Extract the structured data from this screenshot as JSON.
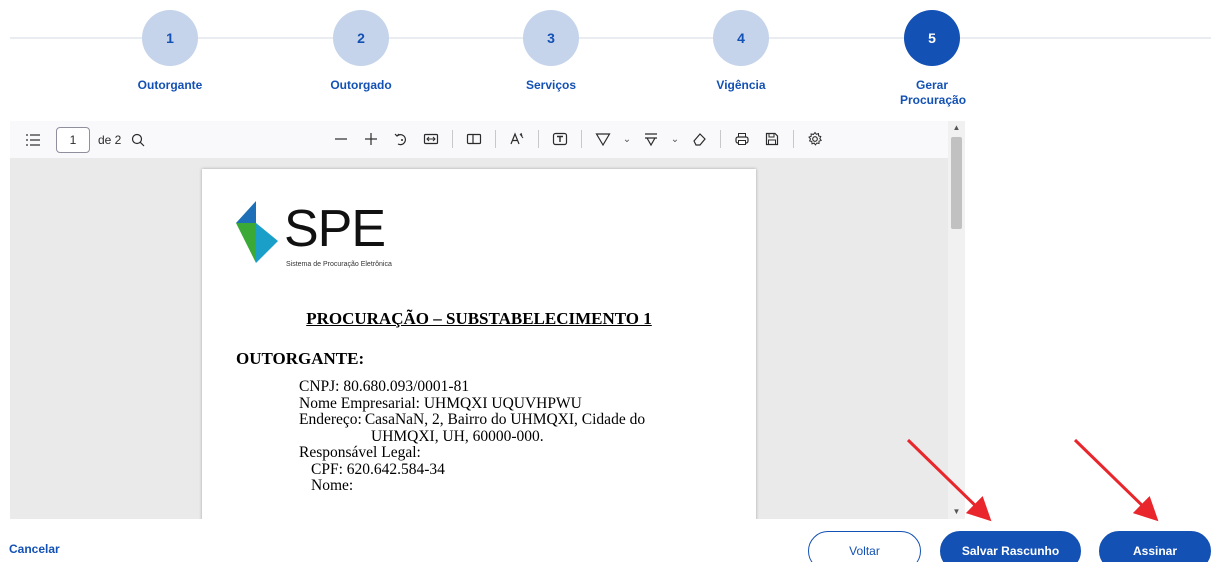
{
  "stepper": {
    "steps": [
      {
        "number": "1",
        "label": "Outorgante"
      },
      {
        "number": "2",
        "label": "Outorgado"
      },
      {
        "number": "3",
        "label": "Serviços"
      },
      {
        "number": "4",
        "label": "Vigência"
      },
      {
        "number": "5",
        "label": "Gerar Procuração"
      }
    ],
    "active_step": 5
  },
  "pdf_toolbar": {
    "page_number": "1",
    "page_count": "de 2",
    "icons": [
      "sidebar-toggle-icon",
      "search-icon",
      "zoom-out-icon",
      "zoom-in-icon",
      "rotate-icon",
      "fit-width-icon",
      "spread-icon",
      "text-icon",
      "text-box-icon",
      "highlight-icon",
      "draw-icon",
      "eraser-icon",
      "print-icon",
      "save-icon",
      "settings-icon"
    ]
  },
  "document": {
    "logo_text": "SPE",
    "logo_subtitle": "Sistema de Procuração Eletrônica",
    "title": "PROCURAÇÃO – SUBSTABELECIMENTO 1",
    "section": "OUTORGANTE:",
    "cnpj": "CNPJ: 80.680.093/0001-81",
    "nome_empresarial": "Nome Empresarial: UHMQXI UQUVHPWU",
    "endereco_label": "Endereço:",
    "endereco_line1": "CasaNaN, 2, Bairro do UHMQXI, Cidade do",
    "endereco_line2": "UHMQXI, UH, 60000-000.",
    "responsavel": "Responsável Legal:",
    "cpf": "CPF: 620.642.584-34",
    "nome": "Nome:"
  },
  "footer": {
    "cancel_label": "Cancelar",
    "back_label": "Voltar",
    "draft_label": "Salvar Rascunho",
    "sign_label": "Assinar"
  },
  "colors": {
    "primary": "#1351b4",
    "step_inactive": "#c5d4eb",
    "annotation_arrow": "#e8262b",
    "logo_green": "#3aa935",
    "logo_blue": "#1d6fb8"
  }
}
